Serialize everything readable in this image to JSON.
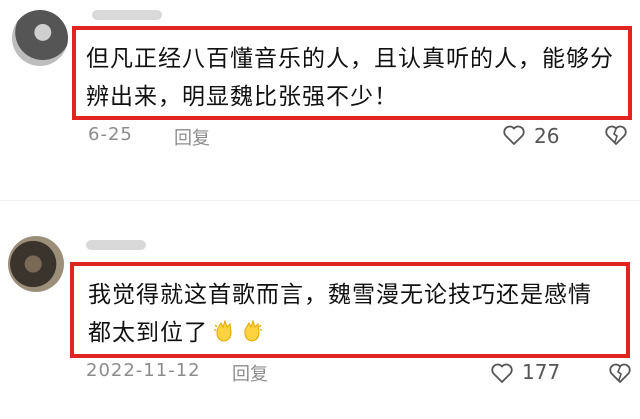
{
  "comments": [
    {
      "text": "但凡正经八百懂音乐的人，且认真听的人，能够分辨出来，明显魏比张强不少！",
      "date": "6-25",
      "reply_label": "回复",
      "likes": "26"
    },
    {
      "text": "我觉得就这首歌而言，魏雪漫无论技巧还是感情都太到位了",
      "date": "2022-11-12",
      "reply_label": "回复",
      "likes": "177",
      "emoji": [
        "clap-icon",
        "clap-icon"
      ]
    }
  ],
  "colors": {
    "highlight_border": "#e0241f",
    "meta_text": "#8c8c8c"
  }
}
